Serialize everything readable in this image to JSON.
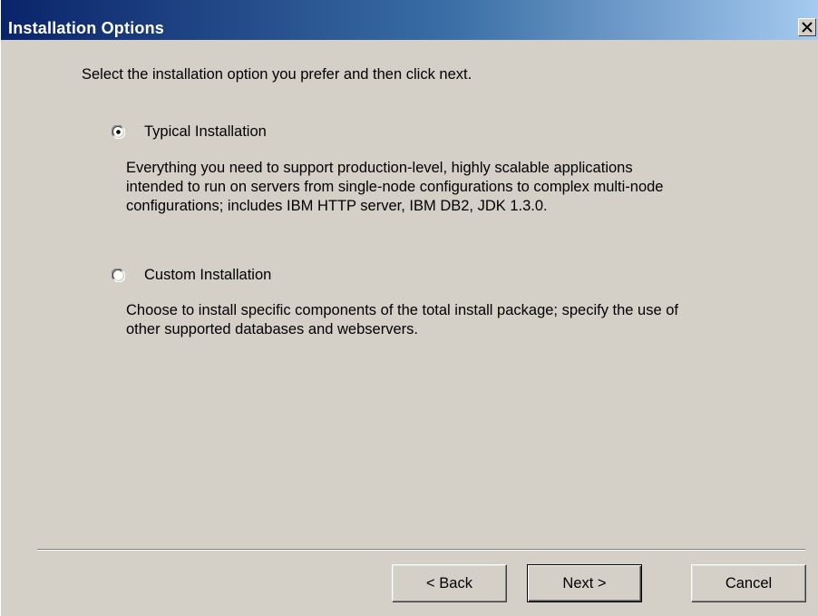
{
  "window": {
    "title": "Installation Options",
    "close_icon": "close-icon",
    "title_gradient": [
      "#0a246a",
      "#a6caf0"
    ]
  },
  "intro": "Select the installation option you prefer and then click next.",
  "options": [
    {
      "label": "Typical Installation",
      "selected": true,
      "description_lines": [
        "Everything you need to support production-level, highly scalable applications",
        "intended to run on servers from single-node configurations to complex multi-node",
        "configurations; includes IBM HTTP server, IBM DB2, JDK 1.3.0."
      ]
    },
    {
      "label": "Custom Installation",
      "selected": false,
      "description_lines": [
        "Choose to install specific components of the total install package; specify the use of",
        "other supported databases and webservers."
      ]
    }
  ],
  "buttons": {
    "back": "< Back",
    "next": "Next >",
    "cancel": "Cancel"
  }
}
